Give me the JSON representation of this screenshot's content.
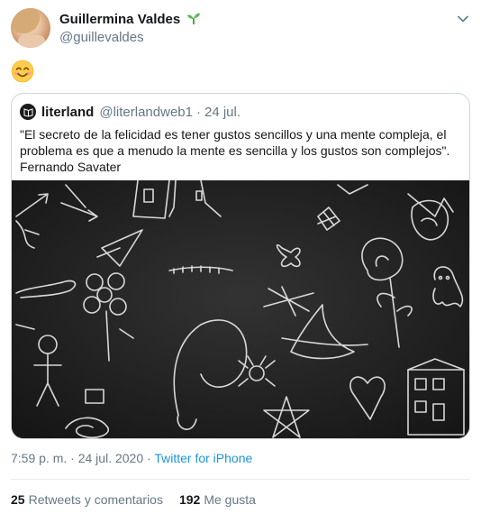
{
  "author": {
    "name": "Guillermina Valdes",
    "handle": "@guillevaldes"
  },
  "tweet": {
    "emoji_icon": "smiling-face-icon"
  },
  "quoted": {
    "name": "literland",
    "handle": "@literlandweb1",
    "separator": "·",
    "date": "24 jul.",
    "text_lines": [
      "\"El secreto de la felicidad es tener gustos sencillos y una mente compleja, el",
      "problema es que a menudo la mente es sencilla y los gustos son complejos\".",
      "Fernando Savater"
    ],
    "image_icon": "chalkboard-doodles-image"
  },
  "meta": {
    "time": "7:59 p. m.",
    "separator": "·",
    "date": "24 jul. 2020",
    "source": "Twitter for iPhone"
  },
  "stats": {
    "retweets_count": "25",
    "retweets_label": "Retweets y comentarios",
    "likes_count": "192",
    "likes_label": "Me gusta"
  },
  "colors": {
    "link": "#1b95e0",
    "secondary_text": "#657786",
    "border": "#ccd6dd"
  }
}
